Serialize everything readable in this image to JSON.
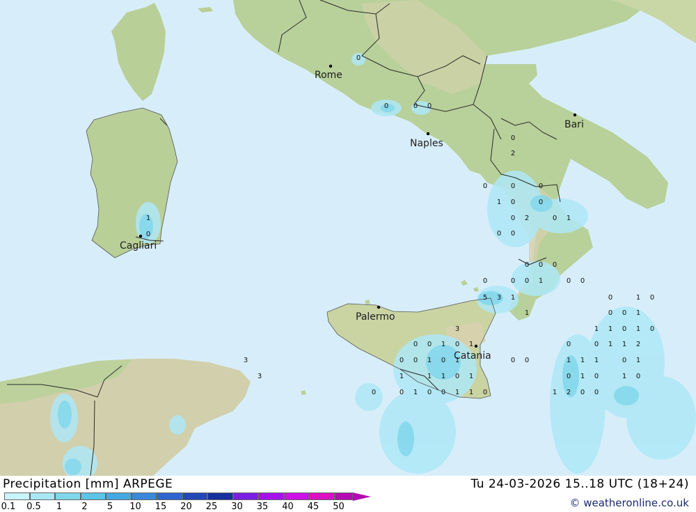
{
  "map": {
    "cities": [
      {
        "name": "Rome"
      },
      {
        "name": "Naples"
      },
      {
        "name": "Bari"
      },
      {
        "name": "Cagliari"
      },
      {
        "name": "Palermo"
      },
      {
        "name": "Catania"
      }
    ],
    "colors": {
      "sea": "#d7eefa",
      "land_low": "#b8d09a",
      "land_high": "#d6cfae",
      "precip_light": "#b3ecf6",
      "precip_mid": "#7fd6ec",
      "border": "#222222"
    },
    "precip_values": [
      "0",
      "1",
      "0",
      "0",
      "0",
      "0",
      "0",
      "2",
      "0",
      "0",
      "0",
      "1",
      "0",
      "0",
      "2",
      "0",
      "0",
      "1",
      "0",
      "0",
      "0",
      "0",
      "0",
      "0",
      "0",
      "0",
      "1",
      "0",
      "0",
      "5",
      "3",
      "1",
      "1",
      "0",
      "1",
      "0",
      "0",
      "0",
      "1",
      "1",
      "1",
      "0",
      "1",
      "0",
      "3",
      "0",
      "0",
      "1",
      "0",
      "1",
      "0",
      "0",
      "1",
      "1",
      "2",
      "3",
      "0",
      "0",
      "1",
      "0",
      "1",
      "0",
      "0",
      "1",
      "1",
      "1",
      "0",
      "1",
      "3",
      "1",
      "1",
      "1",
      "0",
      "1",
      "0",
      "1",
      "0",
      "1",
      "0",
      "0",
      "0",
      "1",
      "0",
      "0",
      "1",
      "1",
      "0",
      "1",
      "2",
      "0",
      "0",
      "1"
    ]
  },
  "footer": {
    "title": "Precipitation [mm] ARPEGE",
    "validity": "Tu 24-03-2026 15..18 UTC (18+24)",
    "credit": "© weatheronline.co.uk"
  },
  "legend": {
    "ticks": [
      "0.1",
      "0.5",
      "1",
      "2",
      "5",
      "10",
      "15",
      "20",
      "25",
      "30",
      "35",
      "40",
      "45",
      "50"
    ],
    "colors": [
      "#c8f4fa",
      "#a8e8f4",
      "#7fd8ea",
      "#5cc4e6",
      "#46a8e2",
      "#3a88dc",
      "#2e66d0",
      "#2248b8",
      "#16309e",
      "#7a1ee6",
      "#a612ee",
      "#cc10e6",
      "#dc10c0",
      "#b40ab4"
    ]
  }
}
